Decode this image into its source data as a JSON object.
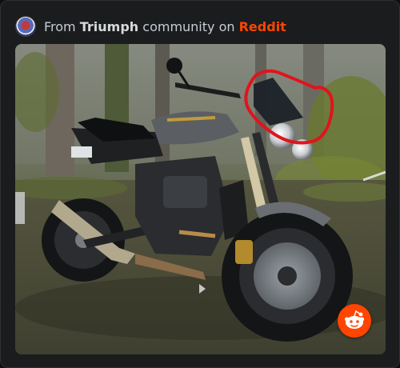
{
  "embed": {
    "header": {
      "prefix": "From",
      "community": "Triumph",
      "middle": "community on",
      "platform": "Reddit"
    },
    "post_image": {
      "subject": "motorcycle-photo",
      "annotation_color": "#e0141c"
    },
    "colors": {
      "platform_accent": "#ff4500",
      "card_background": "#1a1c1e"
    },
    "icons": [
      "subreddit-avatar-icon",
      "reddit-snoo-icon"
    ]
  }
}
